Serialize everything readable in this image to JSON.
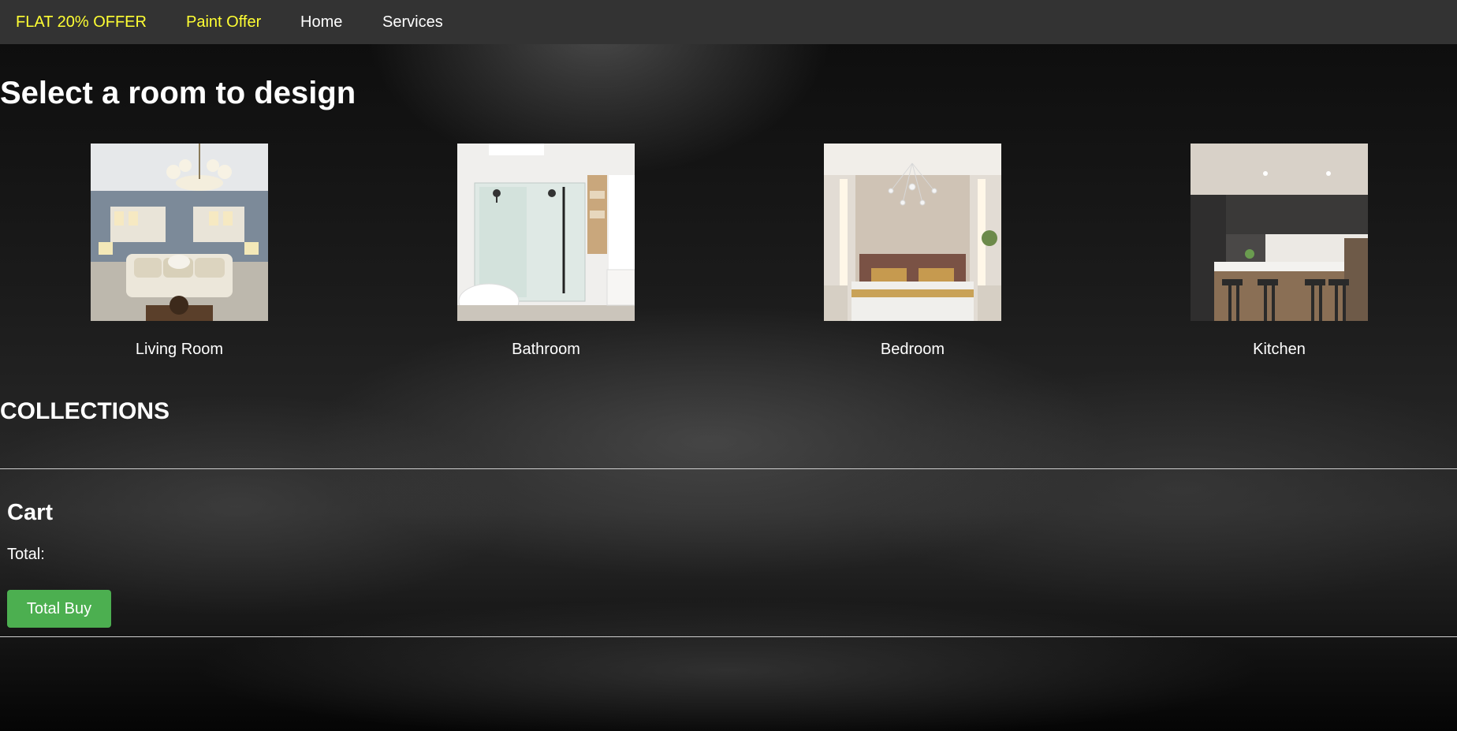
{
  "nav": {
    "items": [
      {
        "label": "FLAT 20% OFFER",
        "color": "#ffff33"
      },
      {
        "label": "Paint Offer",
        "color": "#ffff33"
      },
      {
        "label": "Home",
        "color": "#ffffff"
      },
      {
        "label": "Services",
        "color": "#ffffff"
      }
    ]
  },
  "main": {
    "title": "Select a room to design",
    "rooms": [
      {
        "label": "Living Room"
      },
      {
        "label": "Bathroom"
      },
      {
        "label": "Bedroom"
      },
      {
        "label": "Kitchen"
      }
    ],
    "collections_title": "COLLECTIONS"
  },
  "cart": {
    "title": "Cart",
    "total_label": "Total:",
    "buy_label": "Total Buy",
    "buy_color": "#4caf50"
  }
}
